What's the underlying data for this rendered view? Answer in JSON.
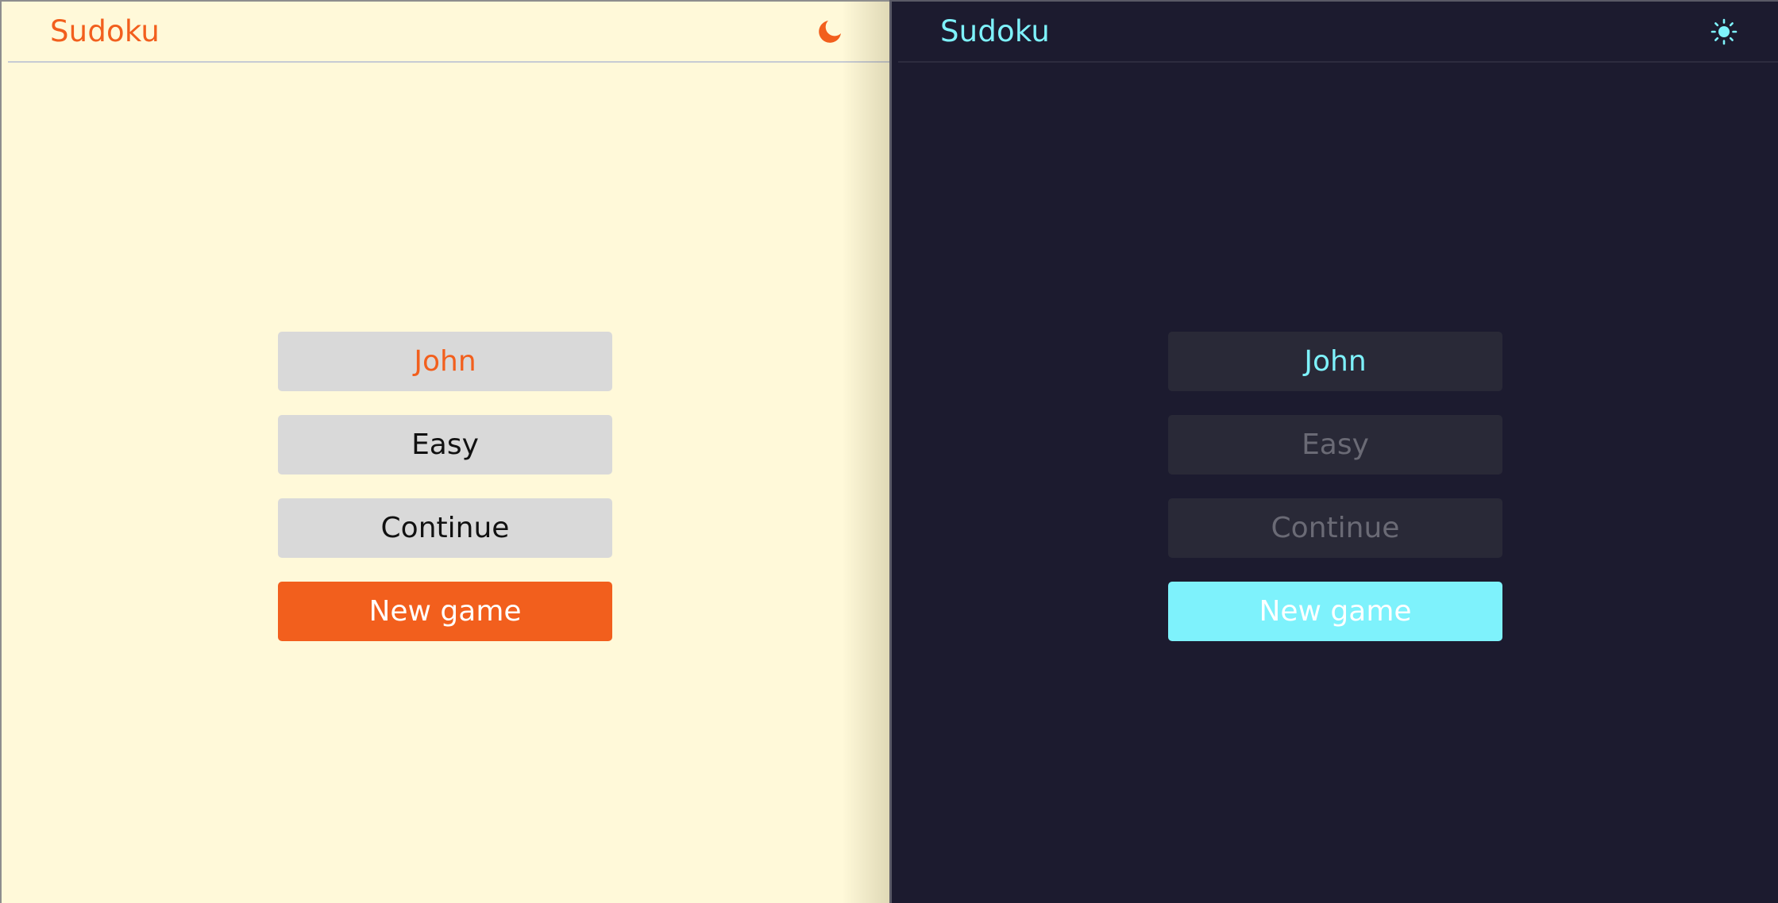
{
  "light": {
    "title": "Sudoku",
    "toggle_icon": "moon-icon",
    "player_name": "John",
    "difficulty": "Easy",
    "continue_label": "Continue",
    "new_game_label": "New game",
    "colors": {
      "background": "#fff9d9",
      "accent": "#f25f1d",
      "button": "#d9d9d9"
    }
  },
  "dark": {
    "title": "Sudoku",
    "toggle_icon": "sun-icon",
    "player_name": "John",
    "difficulty": "Easy",
    "continue_label": "Continue",
    "new_game_label": "New game",
    "colors": {
      "background": "#1c1b2f",
      "accent": "#7ef2fc",
      "button": "#292937"
    }
  }
}
